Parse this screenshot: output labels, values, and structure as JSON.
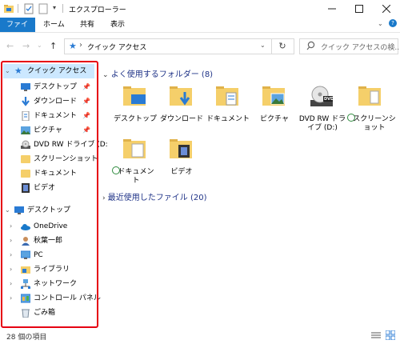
{
  "window": {
    "title": "エクスプローラー"
  },
  "ribbon": {
    "tabs": [
      "ファイル",
      "ホーム",
      "共有",
      "表示"
    ]
  },
  "address": {
    "path": "クイック アクセス",
    "separator": "›",
    "search_placeholder": "クイック アクセスの検..."
  },
  "nav": {
    "quick_access": "クイック アクセス",
    "qa_items": [
      "デスクトップ",
      "ダウンロード",
      "ドキュメント",
      "ピクチャ",
      "DVD RW ドライブ (D:",
      "スクリーンショット",
      "ドキュメント",
      "ビデオ"
    ],
    "desktop": "デスクトップ",
    "desktop_items": [
      "OneDrive",
      "秋葉一郎",
      "PC",
      "ライブラリ",
      "ネットワーク",
      "コントロール パネル",
      "ごみ箱"
    ]
  },
  "content": {
    "frequent_header": "よく使用するフォルダー (8)",
    "recent_header": "最近使用したファイル (20)",
    "tiles": [
      {
        "label": "デスクトップ"
      },
      {
        "label": "ダウンロード"
      },
      {
        "label": "ドキュメント"
      },
      {
        "label": "ピクチャ"
      },
      {
        "label": "DVD RW ドライブ (D:)"
      },
      {
        "label": "スクリーンショット"
      },
      {
        "label": "ドキュメント"
      },
      {
        "label": "ビデオ"
      }
    ],
    "dvd_badge": "DVD"
  },
  "status": {
    "text": "28 個の項目"
  },
  "colors": {
    "accent": "#1979ca",
    "highlight_border": "#e60012",
    "selected_bg": "#cce8ff"
  }
}
